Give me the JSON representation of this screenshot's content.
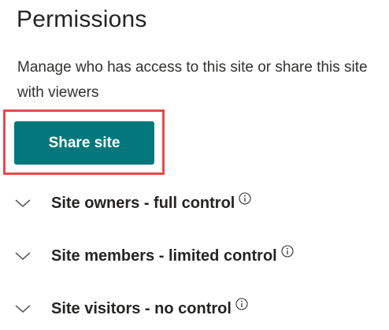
{
  "panel": {
    "title": "Permissions",
    "description": "Manage who has access to this site or share this site with viewers"
  },
  "share_button": {
    "label": "Share site",
    "color": "#03787c",
    "highlight_color": "#e8474c"
  },
  "groups": [
    {
      "label": "Site owners - full control",
      "icon": "chevron-down-icon",
      "info_icon": "info-icon"
    },
    {
      "label": "Site members - limited control",
      "icon": "chevron-down-icon",
      "info_icon": "info-icon"
    },
    {
      "label": "Site visitors - no control",
      "icon": "chevron-down-icon",
      "info_icon": "info-icon"
    }
  ]
}
